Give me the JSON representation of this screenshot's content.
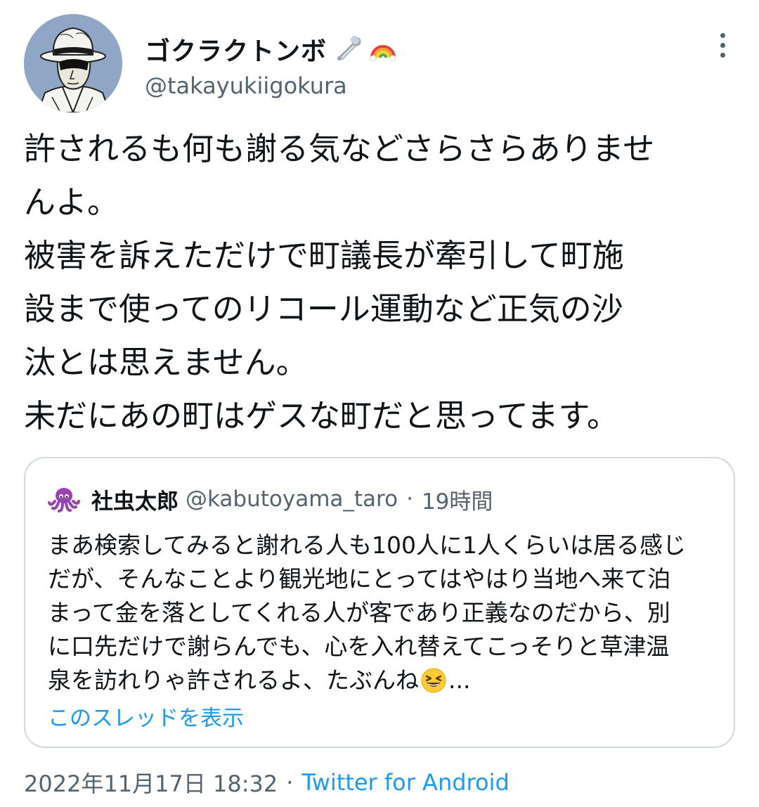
{
  "author": {
    "display_name": "ゴクラクトンボ",
    "name_emojis": [
      "safety-pin",
      "rainbow"
    ],
    "handle": "@takayukiigokura",
    "avatar": "hat-man-illustration"
  },
  "tweet": {
    "lines": [
      "許されるも何も謝る気などさらさらありませ",
      "んよ。",
      "被害を訴えただけで町議長が牽引して町施",
      "設まで使ってのリコール運動など正気の沙",
      "汰とは思えません。",
      "未だにあの町はゲスな町だと思ってます。"
    ]
  },
  "quote": {
    "display_name": "社虫太郎",
    "handle": "@kabutoyama_taro",
    "separator": "·",
    "time": "19時間",
    "avatar": "purple-octopus",
    "lines": [
      "まあ検索してみると謝れる人も100人に1人くらいは居る感じ",
      "だが、そんなことより観光地にとってはやはり当地へ来て泊",
      "まって金を落としてくれる人が客であり正義なのだから、別",
      "に口先だけで謝らんでも、心を入れ替えてこっそりと草津温",
      "泉を訪れりゃ許されるよ、たぶんね"
    ],
    "last_line_emoji": "grinning-squinting-face",
    "ellipsis": "...",
    "thread_link": "このスレッドを表示"
  },
  "meta": {
    "timestamp": "2022年11月17日 18:32",
    "separator": "·",
    "source": "Twitter for Android"
  },
  "colors": {
    "text": "#0f1419",
    "secondary": "#536471",
    "link": "#1d9bf0",
    "border": "#cfd9de"
  }
}
